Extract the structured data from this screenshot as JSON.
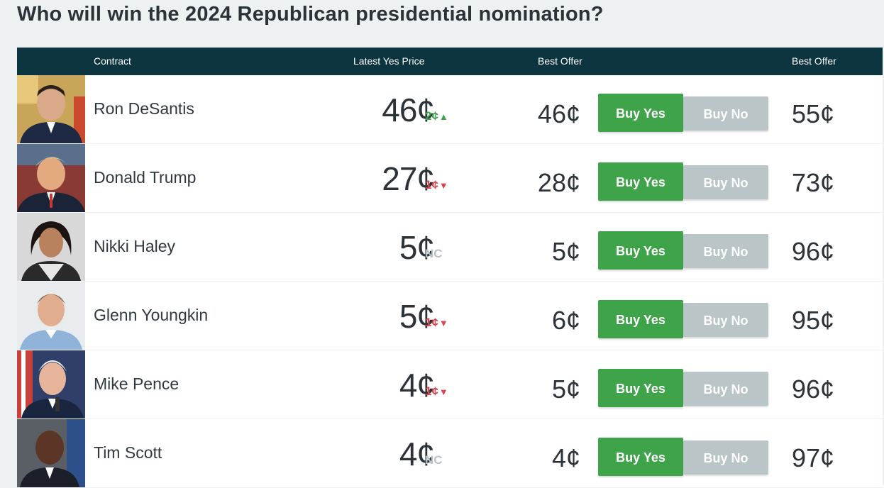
{
  "page": {
    "title": "Who will win the 2024 Republican presidential nomination?"
  },
  "table": {
    "headers": {
      "contract": "Contract",
      "latest": "Latest Yes Price",
      "offer_yes": "Best Offer",
      "offer_no": "Best Offer"
    },
    "buttons": {
      "yes": "Buy Yes",
      "no": "Buy No"
    },
    "rows": [
      {
        "name": "Ron DeSantis",
        "latest": "46¢",
        "change": "2¢",
        "direction": "up",
        "offer_yes": "46¢",
        "offer_no": "55¢"
      },
      {
        "name": "Donald Trump",
        "latest": "27¢",
        "change": "1¢",
        "direction": "down",
        "offer_yes": "28¢",
        "offer_no": "73¢"
      },
      {
        "name": "Nikki Haley",
        "latest": "5¢",
        "change": "NC",
        "direction": "none",
        "offer_yes": "5¢",
        "offer_no": "96¢"
      },
      {
        "name": "Glenn Youngkin",
        "latest": "5¢",
        "change": "1¢",
        "direction": "down",
        "offer_yes": "6¢",
        "offer_no": "95¢"
      },
      {
        "name": "Mike Pence",
        "latest": "4¢",
        "change": "1¢",
        "direction": "down",
        "offer_yes": "5¢",
        "offer_no": "96¢"
      },
      {
        "name": "Tim Scott",
        "latest": "4¢",
        "change": "NC",
        "direction": "none",
        "offer_yes": "4¢",
        "offer_no": "97¢"
      }
    ]
  },
  "colors": {
    "header_bg": "#0d3540",
    "buy_yes": "#3fa34a",
    "buy_no": "#b9c5c7",
    "up": "#3fa34a",
    "down": "#d8464b",
    "nc": "#b7c3c7"
  },
  "icons": {
    "up": "arrow-up-icon",
    "down": "arrow-down-icon"
  }
}
